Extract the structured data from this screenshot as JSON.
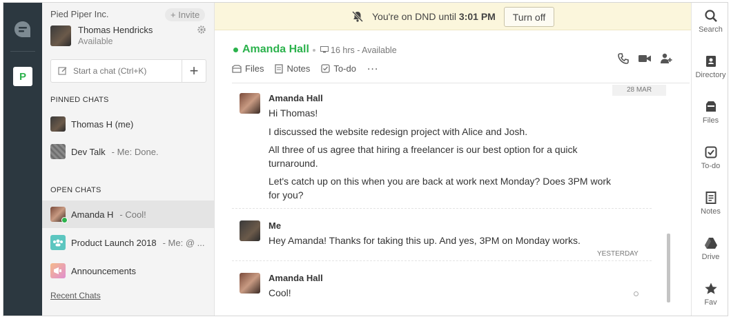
{
  "org": {
    "name": "Pied Piper Inc.",
    "badge": "P",
    "invite_label": "+ Invite"
  },
  "me": {
    "name": "Thomas Hendricks",
    "status": "Available"
  },
  "search": {
    "placeholder": "Start a chat (Ctrl+K)"
  },
  "pinned": {
    "title": "PINNED CHATS",
    "items": [
      {
        "name": "Thomas H (me)",
        "preview": ""
      },
      {
        "name": "Dev Talk",
        "preview": "- Me: Done."
      }
    ]
  },
  "open": {
    "title": "OPEN CHATS",
    "items": [
      {
        "name": "Amanda H",
        "preview": "- Cool!"
      },
      {
        "name": "Product Launch 2018",
        "preview": "- Me: @ ..."
      },
      {
        "name": "Announcements",
        "preview": ""
      }
    ]
  },
  "recent_link": "Recent Chats",
  "dnd": {
    "text_prefix": "You're on DND until",
    "time": "3:01 PM",
    "button": "Turn off"
  },
  "chat_header": {
    "name": "Amanda Hall",
    "status": "16 hrs - Available"
  },
  "tabs": {
    "files": "Files",
    "notes": "Notes",
    "todo": "To-do",
    "more": "..."
  },
  "date_label": "28 MAR",
  "messages": [
    {
      "sender": "Amanda Hall",
      "lines": [
        "Hi Thomas!",
        "I discussed the website redesign project with Alice and Josh.",
        "All three of us agree that hiring a freelancer is our best option for a quick turnaround.",
        "Let's catch up on this when you are back at work next Monday? Does 3PM work for you?"
      ]
    },
    {
      "sender": "Me",
      "lines": [
        "Hey Amanda! Thanks for taking this up. And yes, 3PM on Monday works."
      ]
    },
    {
      "sender": "Amanda Hall",
      "lines": [
        "Cool!"
      ]
    }
  ],
  "yesterday_label": "YESTERDAY",
  "right_nav": {
    "search": "Search",
    "directory": "Directory",
    "files": "Files",
    "todo": "To-do",
    "notes": "Notes",
    "drive": "Drive",
    "fav": "Fav"
  },
  "colors": {
    "accent": "#2bb24c",
    "rail": "#2c3840",
    "dnd_bg": "#fbf6dc"
  }
}
